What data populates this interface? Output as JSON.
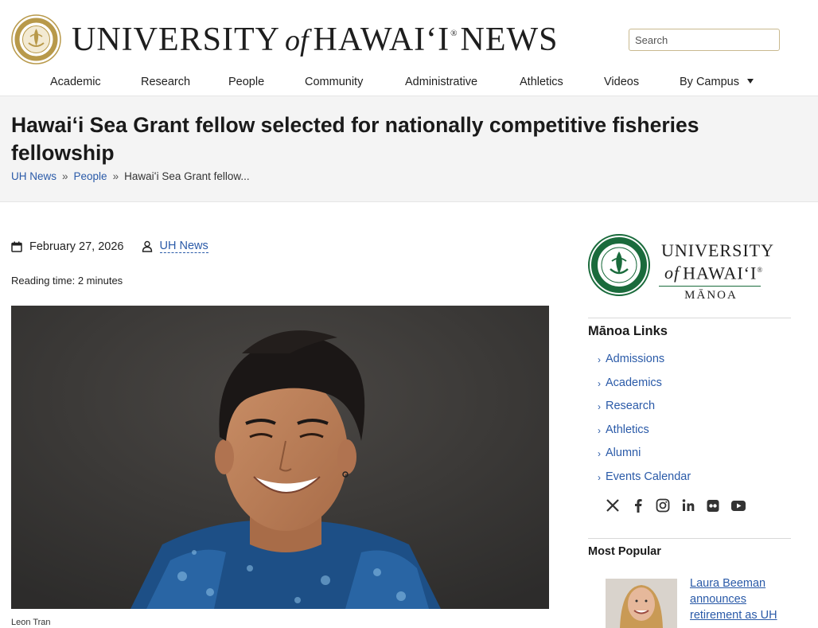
{
  "header": {
    "masthead": {
      "word1": "UNIVERSITY",
      "word2": "of",
      "word3": "HAWAIʻI",
      "reg": "®",
      "word4": "NEWS"
    },
    "search_placeholder": "Search"
  },
  "nav": {
    "items": [
      "Academic",
      "Research",
      "People",
      "Community",
      "Administrative",
      "Athletics",
      "Videos",
      "By Campus"
    ]
  },
  "article": {
    "title": "Hawaiʻi Sea Grant fellow selected for nationally competitive fisheries fellowship",
    "breadcrumb": [
      "UH News",
      "People",
      "Hawaiʻi Sea Grant fellow..."
    ],
    "breadcrumb_sep": "»",
    "date": "February 27, 2026",
    "author": "UH News",
    "reading_time": "Reading time: 2 minutes",
    "photo_caption": "Leon Tran"
  },
  "sidebar": {
    "logo": {
      "line1": "UNIVERSITY",
      "line2_of": "of",
      "line2": "HAWAIʻI",
      "reg": "®",
      "line3": "MĀNOA"
    },
    "links_heading": "Mānoa Links",
    "links": [
      "Admissions",
      "Academics",
      "Research",
      "Athletics",
      "Alumni",
      "Events Calendar"
    ],
    "social_icons": [
      "x-icon",
      "facebook-icon",
      "instagram-icon",
      "linkedin-icon",
      "flickr-icon",
      "youtube-icon"
    ],
    "popular_heading": "Most Popular",
    "popular_item": "Laura Beeman announces retirement as UH"
  },
  "colors": {
    "link": "#2a5aa8",
    "gold_seal": "#b8994a",
    "manoa_green": "#1a6b3c",
    "band_bg": "#f4f4f4"
  }
}
